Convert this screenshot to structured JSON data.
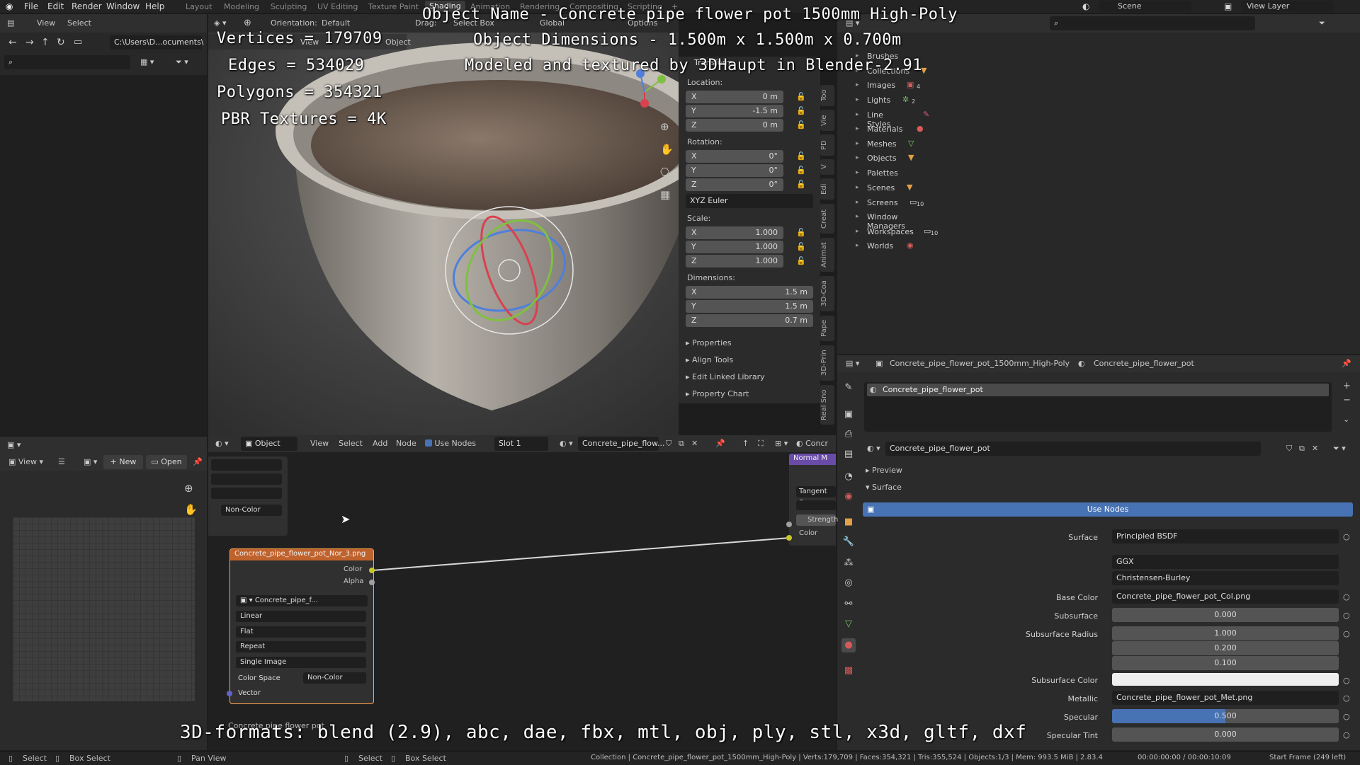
{
  "menu": {
    "file": "File",
    "edit": "Edit",
    "render": "Render",
    "window": "Window",
    "help": "Help"
  },
  "workspaces": [
    "Layout",
    "Modeling",
    "Sculpting",
    "UV Editing",
    "Texture Paint",
    "Shading",
    "Animation",
    "Rendering",
    "Compositing",
    "Scripting"
  ],
  "active_workspace": "Shading",
  "topbar_right": {
    "scene": "Scene",
    "view_layer": "View Layer"
  },
  "viewport_header": {
    "orientation_label": "Orientation:",
    "orientation_value": "Default",
    "drag_label": "Drag:",
    "drag_value": "Select Box",
    "transform_space": "Global",
    "options": "Options",
    "view": "View",
    "object": "Object"
  },
  "file_browser": {
    "view": "View",
    "select": "Select",
    "path": "C:\\Users\\D...ocuments\\"
  },
  "overlay_text": {
    "vertices": "Vertices = 179709",
    "edges": "Edges = 534029",
    "polygons": "Polygons = 354321",
    "pbr": "PBR Textures = 4K",
    "object_name": "Object Name - Concrete pipe flower pot 1500mm High-Poly",
    "object_dimensions": "Object Dimensions - 1.500m x 1.500m x 0.700m",
    "modeled_by": "Modeled and textured by 3DHaupt in Blender-2.91",
    "formats": "3D-formats: blend (2.9), abc, dae, fbx, mtl, obj, ply, stl, x3d, gltf, dxf"
  },
  "n_panel": {
    "transform_title": "Transform",
    "location_label": "Location:",
    "location": [
      {
        "axis": "X",
        "value": "0 m"
      },
      {
        "axis": "Y",
        "value": "-1.5 m"
      },
      {
        "axis": "Z",
        "value": "0 m"
      }
    ],
    "rotation_label": "Rotation:",
    "rotation": [
      {
        "axis": "X",
        "value": "0°"
      },
      {
        "axis": "Y",
        "value": "0°"
      },
      {
        "axis": "Z",
        "value": "0°"
      }
    ],
    "rotation_mode": "XYZ Euler",
    "scale_label": "Scale:",
    "scale": [
      {
        "axis": "X",
        "value": "1.000"
      },
      {
        "axis": "Y",
        "value": "1.000"
      },
      {
        "axis": "Z",
        "value": "1.000"
      }
    ],
    "dimensions_label": "Dimensions:",
    "dimensions": [
      {
        "axis": "X",
        "value": "1.5 m"
      },
      {
        "axis": "Y",
        "value": "1.5 m"
      },
      {
        "axis": "Z",
        "value": "0.7 m"
      }
    ],
    "sections": [
      "Properties",
      "Align Tools",
      "Edit Linked Library",
      "Property Chart"
    ],
    "tabs": [
      "Too",
      "Vie",
      "PD",
      "V",
      "Edi",
      "Creat",
      "Animat",
      "3D-Coa",
      "Pape",
      "3D-Prin",
      "Real Sno"
    ]
  },
  "outliner": {
    "items": [
      "Brushes",
      "Collections",
      "Images",
      "Lights",
      "Line Styles",
      "Materials",
      "Meshes",
      "Objects",
      "Palettes",
      "Scenes",
      "Screens",
      "Window Managers",
      "Workspaces",
      "Worlds"
    ],
    "badges": {
      "images": "4",
      "lights": "2",
      "screens": "10",
      "workspaces": "10"
    }
  },
  "image_editor": {
    "view": "View",
    "new": "New",
    "open": "Open"
  },
  "node_editor": {
    "object_mode": "Object",
    "view": "View",
    "select": "Select",
    "add": "Add",
    "node": "Node",
    "use_nodes": "Use Nodes",
    "slot": "Slot 1",
    "material": "Concrete_pipe_flow...",
    "right_material": "Concr",
    "left_node_colorspace": "Non-Color",
    "texture_node": {
      "title": "Concrete_pipe_flower_pot_Nor_3.png",
      "out_color": "Color",
      "out_alpha": "Alpha",
      "image": "Concrete_pipe_f...",
      "interpolation": "Linear",
      "projection": "Flat",
      "extension": "Repeat",
      "source": "Single Image",
      "color_space_label": "Color Space",
      "color_space": "Non-Color",
      "in_vector": "Vector"
    },
    "normal_map_node": {
      "title": "Normal M",
      "space": "Tangent Sp",
      "strength": "Strength",
      "color": "Color"
    },
    "frame_label": "Concrete pipe flower pot"
  },
  "properties": {
    "object_name": "Concrete_pipe_flower_pot_1500mm_High-Poly",
    "material_name": "Concrete_pipe_flower_pot",
    "slot_item": "Concrete_pipe_flower_pot",
    "material_field": "Concrete_pipe_flower_pot",
    "preview": "Preview",
    "surface_section": "Surface",
    "use_nodes": "Use Nodes",
    "rows": {
      "surface_label": "Surface",
      "surface_value": "Principled BSDF",
      "distribution": "GGX",
      "sss_method": "Christensen-Burley",
      "base_color_label": "Base Color",
      "base_color_value": "Concrete_pipe_flower_pot_Col.png",
      "subsurface_label": "Subsurface",
      "subsurface_value": "0.000",
      "subsurface_radius_label": "Subsurface Radius",
      "subsurface_radius": [
        "1.000",
        "0.200",
        "0.100"
      ],
      "subsurface_color_label": "Subsurface Color",
      "metallic_label": "Metallic",
      "metallic_value": "Concrete_pipe_flower_pot_Met.png",
      "specular_label": "Specular",
      "specular_value": "0.500",
      "specular_tint_label": "Specular Tint",
      "specular_tint_value": "0.000"
    }
  },
  "statusbar": {
    "select": "Select",
    "box_select": "Box Select",
    "pan_view": "Pan View",
    "select2": "Select",
    "box_select2": "Box Select",
    "info": "Collection | Concrete_pipe_flower_pot_1500mm_High-Poly | Verts:179,709 | Faces:354,321 | Tris:355,524 | Objects:1/3 | Mem: 993.5 MiB | 2.83.4",
    "timecode": "00:00:00:00 / 00:00:10:09",
    "start_frame": "Start Frame (249 left)"
  },
  "colors": {
    "accent_blue": "#4772b3",
    "node_orange": "#c0622c",
    "normal_map_purple": "#6a4ca8",
    "socket_yellow": "#c7c729"
  }
}
